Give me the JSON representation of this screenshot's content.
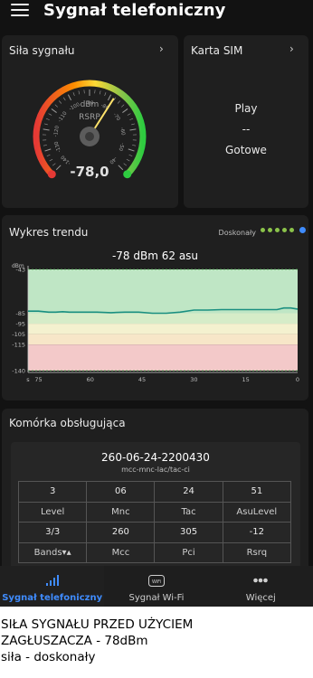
{
  "header": {
    "title": "Sygnał telefoniczny"
  },
  "signal_card": {
    "title": "Siła sygnału",
    "chevron": "›",
    "unit": "dBm",
    "metric": "RSRP",
    "value": "-78,0",
    "gauge_value": -78,
    "gauge_ticks": [
      "-140",
      "-130",
      "-120",
      "-110",
      "-100",
      "-90",
      "-80",
      "-70",
      "-60",
      "-50",
      "-40"
    ]
  },
  "sim_card": {
    "title": "Karta SIM",
    "chevron": "›",
    "operator": "Play",
    "dash": "--",
    "status": "Gotowe"
  },
  "trend_card": {
    "title": "Wykres trendu",
    "legend": "Doskonały",
    "reading": "-78 dBm  62 asu",
    "colors": {
      "line": "#1a8f80",
      "excellent": "#bfe6c5",
      "good": "#d6ecc8",
      "fair": "#f4f1cf",
      "poor": "#f7e6c8",
      "bad": "#f3c9c9",
      "dots": "#8bc34a",
      "info": "#3f8cff"
    }
  },
  "chart_data": {
    "type": "line",
    "ylabel": "dBm",
    "y_ticks": [
      "-43",
      "-85",
      "-95",
      "-105",
      "-115",
      "-140"
    ],
    "x_ticks": [
      "75",
      "60",
      "45",
      "30",
      "15",
      "0"
    ],
    "x_label_start": "s",
    "ylim": [
      -145,
      -40
    ],
    "xlim": [
      78,
      0
    ],
    "x": [
      78,
      75,
      72,
      70,
      68,
      66,
      62,
      58,
      54,
      50,
      46,
      42,
      38,
      34,
      30,
      26,
      22,
      18,
      14,
      10,
      6,
      4,
      2,
      1,
      0
    ],
    "values": [
      -83,
      -83,
      -84,
      -84,
      -83.5,
      -84,
      -84,
      -84,
      -84.5,
      -84,
      -84,
      -85,
      -85,
      -84,
      -82,
      -82,
      -81.5,
      -81.5,
      -81.5,
      -81.5,
      -81.5,
      -80,
      -80,
      -80.5,
      -81
    ]
  },
  "cell_card": {
    "title": "Komórka obsługująca",
    "cell_id": "260-06-24-2200430",
    "cell_format": "mcc-mnc-lac/tac-ci",
    "rows": [
      [
        "3",
        "06",
        "24",
        "51"
      ],
      [
        "Level",
        "Mnc",
        "Tac",
        "AsuLevel"
      ],
      [
        "3/3",
        "260",
        "305",
        "-12"
      ],
      [
        "Bands▾▴",
        "Mcc",
        "Pci",
        "Rsrq"
      ]
    ]
  },
  "nav": {
    "items": [
      {
        "label": "Sygnał telefoniczny",
        "icon": "signal-bars-icon"
      },
      {
        "label": "Sygnał Wi-Fi",
        "icon": "wifi-icon"
      },
      {
        "label": "Więcej",
        "icon": "more-dots-icon"
      }
    ]
  },
  "caption": {
    "line1": "SIŁA SYGNAŁU PRZED UŻYCIEM",
    "line2": "ZAGŁUSZACZA - 78dBm",
    "line3": "siła - doskonały"
  }
}
